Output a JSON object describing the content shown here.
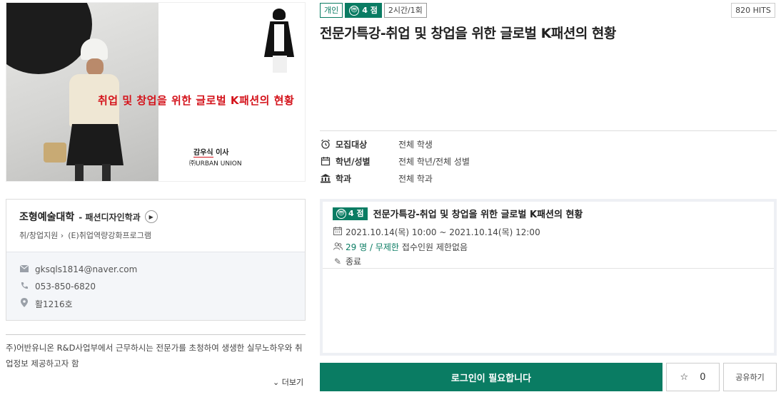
{
  "poster": {
    "headline": "취업 및 창업을 위한 글로벌 K패션의 현황",
    "speaker_name": "감우식",
    "speaker_role": "이사",
    "speaker_org": "㈜URBAN UNION"
  },
  "badges": {
    "type": "개인",
    "points": "4 점",
    "duration": "2시간/1회",
    "hits": "820 HITS",
    "m_icon": "ⓜ"
  },
  "title": "전문가특강-취업 및 창업을 위한 글로벌 K패션의 현황",
  "info": [
    {
      "icon": "alarm-clock-icon",
      "label": "모집대상",
      "value": "전체 학생"
    },
    {
      "icon": "calendar-icon",
      "label": "학년/성별",
      "value": "전체 학년/전체 성별"
    },
    {
      "icon": "building-icon",
      "label": "학과",
      "value": "전체 학과"
    }
  ],
  "org": {
    "college": "조형예술대학",
    "department": "- 패션디자인학과",
    "category": "취/창업지원",
    "program": "(E)취업역량강화프로그램",
    "email": "gksqls1814@naver.com",
    "phone": "053-850-6820",
    "location": "활1216호"
  },
  "description": "주)어반유니온 R&D사업부에서 근무하시는 전문가를 초청하여 생생한 실무노하우와 취업정보 제공하고자 함",
  "more_label": "더보기",
  "session": {
    "badge": "4 점",
    "title": "전문가특강-취업 및 창업을 위한 글로벌 K패션의 현황",
    "datetime": "2021.10.14(목) 10:00 ~ 2021.10.14(목) 12:00",
    "capacity": "29 명 / 무제한",
    "capacity_note": "접수인원 제한없음",
    "status": "종료"
  },
  "buttons": {
    "login": "로그인이 필요합니다",
    "star_count": "0",
    "share": "공유하기"
  },
  "colors": {
    "accent": "#0a7c63",
    "headline_red": "#d4131b"
  }
}
